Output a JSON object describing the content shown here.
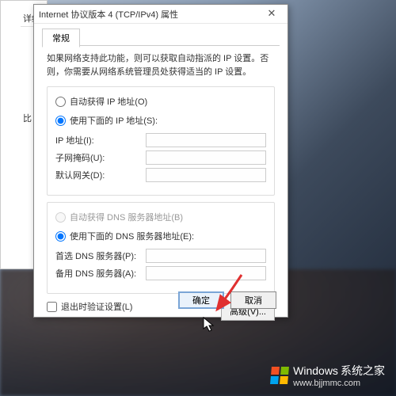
{
  "outer": {
    "label1": "详细",
    "label2": "比"
  },
  "dialog": {
    "title": "Internet 协议版本 4 (TCP/IPv4) 属性",
    "close": "✕",
    "tab": "常规",
    "description": "如果网络支持此功能，则可以获取自动指派的 IP 设置。否则，你需要从网络系统管理员处获得适当的 IP 设置。",
    "ip_group": {
      "auto": "自动获得 IP 地址(O)",
      "manual": "使用下面的 IP 地址(S):",
      "ip_label": "IP 地址(I):",
      "mask_label": "子网掩码(U):",
      "gateway_label": "默认网关(D):",
      "ip_value": "",
      "mask_value": "",
      "gateway_value": ""
    },
    "dns_group": {
      "auto": "自动获得 DNS 服务器地址(B)",
      "manual": "使用下面的 DNS 服务器地址(E):",
      "pref_label": "首选 DNS 服务器(P):",
      "alt_label": "备用 DNS 服务器(A):",
      "pref_value": "",
      "alt_value": ""
    },
    "validate": "退出时验证设置(L)",
    "advanced": "高级(V)...",
    "ok": "确定",
    "cancel": "取消"
  },
  "watermark": {
    "brand": "Windows",
    "site_cn": "系统之家",
    "site_url": "www.bjjmmc.com"
  }
}
